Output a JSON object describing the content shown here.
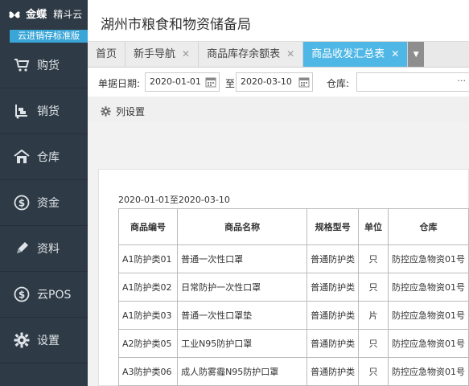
{
  "app": {
    "brand": "金蝶",
    "sub": "精斗云",
    "edition": "云进销存标准版"
  },
  "sidebar": {
    "items": [
      {
        "label": "购货",
        "icon": "cart-icon"
      },
      {
        "label": "销货",
        "icon": "trolley-icon"
      },
      {
        "label": "仓库",
        "icon": "warehouse-icon"
      },
      {
        "label": "资金",
        "icon": "dollar-icon"
      },
      {
        "label": "资料",
        "icon": "pencil-icon"
      },
      {
        "label": "云POS",
        "icon": "pos-icon"
      },
      {
        "label": "设置",
        "icon": "gear-icon"
      }
    ]
  },
  "header": {
    "org": "湖州市粮食和物资储备局"
  },
  "tabs": [
    {
      "label": "首页",
      "closable": false,
      "active": false
    },
    {
      "label": "新手导航",
      "closable": true,
      "active": false
    },
    {
      "label": "商品库存余额表",
      "closable": true,
      "active": false
    },
    {
      "label": "商品收发汇总表",
      "closable": true,
      "active": true
    }
  ],
  "filter": {
    "date_label": "单据日期:",
    "start_date": "2020-01-01",
    "to_label": "至",
    "end_date": "2020-03-10",
    "warehouse_label": "仓库:",
    "warehouse_value": "",
    "more": "···"
  },
  "colset": {
    "label": "列设置"
  },
  "report": {
    "range": "2020-01-01至2020-03-10",
    "headers": [
      "商品编号",
      "商品名称",
      "规格型号",
      "单位",
      "仓库"
    ],
    "rows": [
      [
        "A1防护类01",
        "普通一次性口罩",
        "普通防护类",
        "只",
        "防控应急物资01号"
      ],
      [
        "A1防护类02",
        "日常防护一次性口罩",
        "普通防护类",
        "只",
        "防控应急物资01号"
      ],
      [
        "A1防护类03",
        "普通一次性口罩垫",
        "普通防护类",
        "片",
        "防控应急物资01号"
      ],
      [
        "A2防护类05",
        "工业N95防护口罩",
        "普通防护类",
        "只",
        "防控应急物资01号"
      ],
      [
        "A3防护类06",
        "成人防雾霾N95防护口罩",
        "普通防护类",
        "只",
        "防控应急物资01号"
      ]
    ]
  },
  "colors": {
    "sidebar_bg": "#2e3a45",
    "edition_bg": "#3aa6d8",
    "active_tab": "#4fb7e6"
  }
}
